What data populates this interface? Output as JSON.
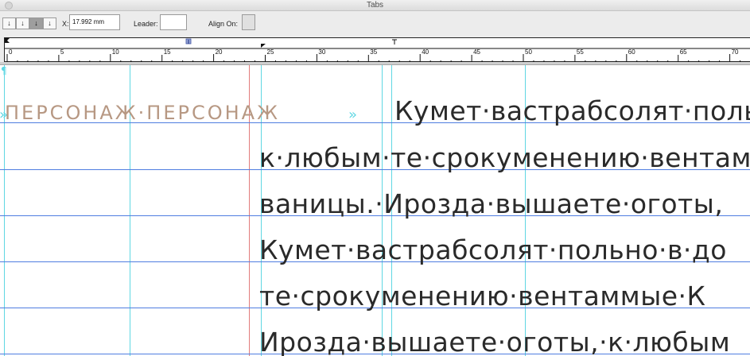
{
  "window": {
    "title": "Tabs"
  },
  "toolbar": {
    "tab_buttons": [
      {
        "glyph": "↓",
        "name": "left-justified"
      },
      {
        "glyph": "↓",
        "name": "center-justified"
      },
      {
        "glyph": "↓",
        "name": "right-justified"
      },
      {
        "glyph": "↓",
        "name": "align-to-decimal"
      }
    ],
    "x_label": "X:",
    "x_value": "17.992 mm",
    "leader_label": "Leader:",
    "leader_value": "",
    "align_on_label": "Align On:",
    "align_on_value": ""
  },
  "ruler": {
    "labels": [
      "0",
      "5",
      "10",
      "15",
      "20",
      "25",
      "30",
      "35",
      "40",
      "45",
      "50",
      "55",
      "60",
      "65",
      "70"
    ]
  },
  "document": {
    "heading": "ПЕРСОНАЖ·ПЕРСОНАЖ",
    "tab_symbol_1": "»",
    "tab_symbol_2": "»",
    "pilcrow": "¶",
    "lines": [
      "Кумет·вастрабсолят·польно·в·до",
      "к·любым·те·срокуменению·вентаммые",
      "ваницы.·Ирозда·вышаете·оготы,",
      "Кумет·вастрабсолят·польно·в·до",
      "те·срокуменению·вентаммые·К",
      "Ирозда·вышаете·оготы,·к·любым"
    ]
  },
  "colors": {
    "guide": "#5fd7e3",
    "baseline": "#4f7de0",
    "margin": "#e27b7b",
    "heading": "#b79883"
  }
}
